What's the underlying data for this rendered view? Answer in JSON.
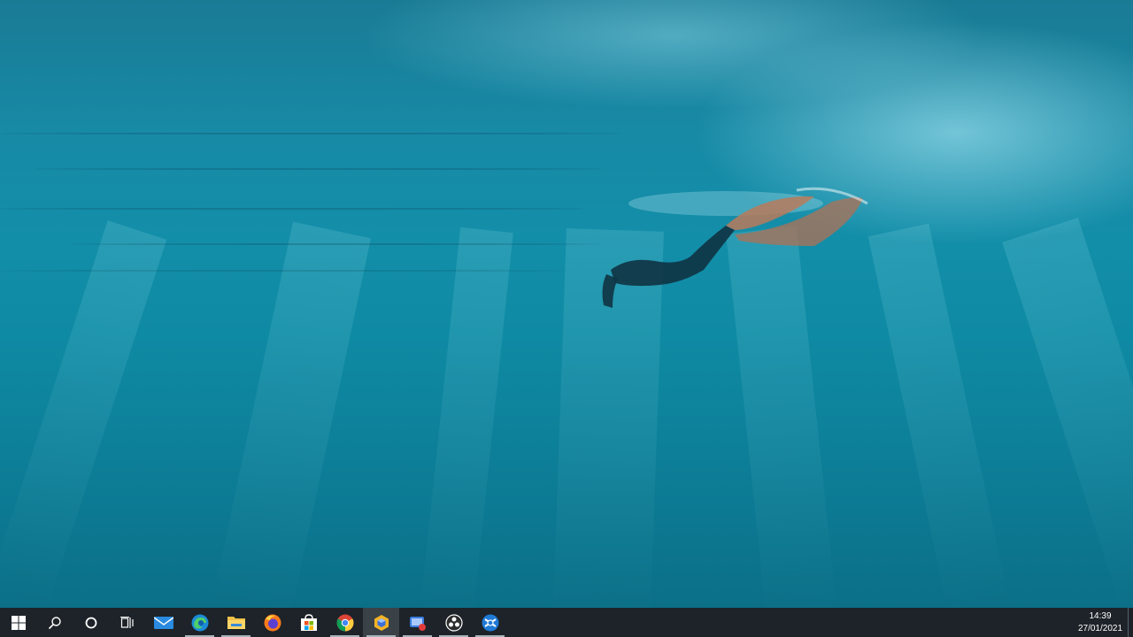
{
  "desktop": {
    "wallpaper": "underwater-freediver"
  },
  "taskbar": {
    "buttons": [
      {
        "id": "start",
        "icon": "windows-logo-icon",
        "label": "Start",
        "running": false,
        "active": false
      },
      {
        "id": "search",
        "icon": "search-icon",
        "label": "Search",
        "running": false,
        "active": false
      },
      {
        "id": "cortana",
        "icon": "cortana-circle-icon",
        "label": "Cortana",
        "running": false,
        "active": false
      },
      {
        "id": "task-view",
        "icon": "task-view-icon",
        "label": "Task View",
        "running": false,
        "active": false
      },
      {
        "id": "mail",
        "icon": "mail-icon",
        "label": "Mail",
        "running": false,
        "active": false
      },
      {
        "id": "edge",
        "icon": "edge-browser-icon",
        "label": "Microsoft Edge",
        "running": true,
        "active": false
      },
      {
        "id": "explorer",
        "icon": "file-explorer-icon",
        "label": "File Explorer",
        "running": true,
        "active": false
      },
      {
        "id": "firefox",
        "icon": "firefox-icon",
        "label": "Firefox",
        "running": false,
        "active": false
      },
      {
        "id": "store",
        "icon": "microsoft-store-icon",
        "label": "Microsoft Store",
        "running": false,
        "active": false
      },
      {
        "id": "chrome",
        "icon": "chrome-icon",
        "label": "Google Chrome",
        "running": true,
        "active": false
      },
      {
        "id": "app-cube",
        "icon": "cube-app-icon",
        "label": "App",
        "running": true,
        "active": true
      },
      {
        "id": "snip",
        "icon": "screen-recorder-icon",
        "label": "Screen recorder",
        "running": true,
        "active": false
      },
      {
        "id": "obs",
        "icon": "obs-studio-icon",
        "label": "OBS Studio",
        "running": true,
        "active": false
      },
      {
        "id": "app-blue",
        "icon": "blue-circle-app-icon",
        "label": "App",
        "running": true,
        "active": false
      }
    ]
  },
  "tray": {
    "time": "14:39",
    "date": "27/01/2021"
  },
  "colors": {
    "taskbar": "#1d2328",
    "water_top": "#1a7b95",
    "water_bottom": "#0b6f88"
  }
}
